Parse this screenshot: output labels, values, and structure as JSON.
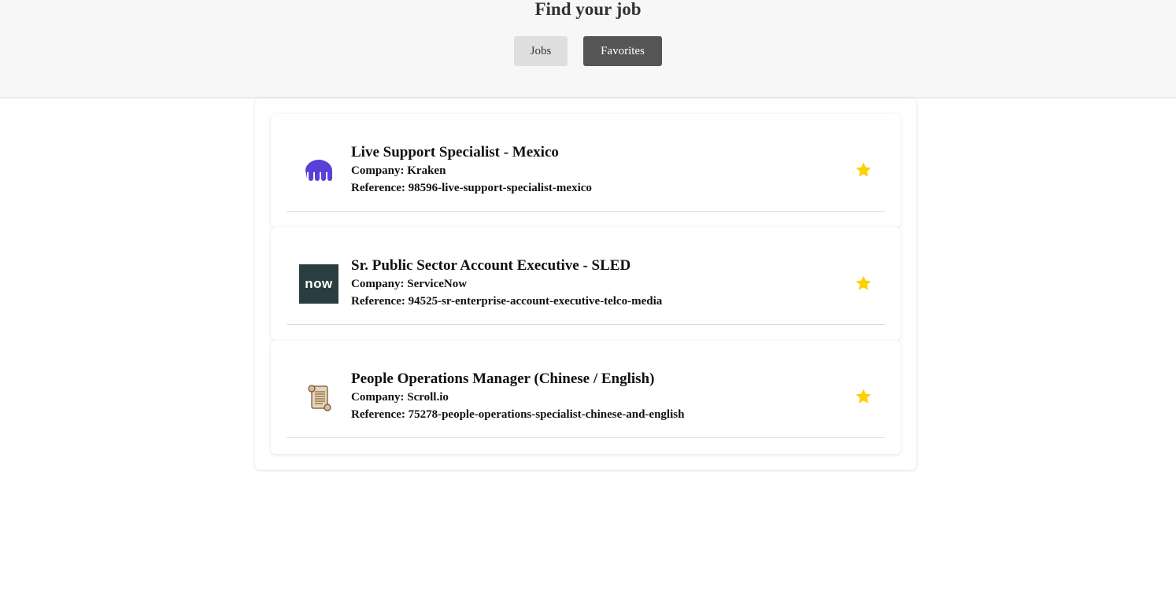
{
  "header": {
    "title": "Find your job",
    "nav": {
      "jobs_label": "Jobs",
      "favorites_label": "Favorites"
    }
  },
  "colors": {
    "accent_star": "#FFD000",
    "kraken_purple": "#5741D9",
    "servicenow_bg": "#293E40",
    "servicenow_green": "#81B5A1",
    "active_tab_bg": "#555555"
  },
  "jobs": [
    {
      "title": "Live Support Specialist - Mexico",
      "company_line": "Company: Kraken",
      "reference_line": "Reference: 98596-live-support-specialist-mexico",
      "logo_icon": "kraken-logo-icon",
      "favorited": true
    },
    {
      "title": "Sr. Public Sector Account Executive - SLED",
      "company_line": "Company: ServiceNow",
      "reference_line": "Reference: 94525-sr-enterprise-account-executive-telco-media",
      "logo_icon": "servicenow-logo-icon",
      "logo_text": "now",
      "favorited": true
    },
    {
      "title": "People Operations Manager (Chinese / English)",
      "company_line": "Company: Scroll.io",
      "reference_line": "Reference: 75278-people-operations-specialist-chinese-and-english",
      "logo_icon": "scroll-logo-icon",
      "favorited": true
    }
  ]
}
